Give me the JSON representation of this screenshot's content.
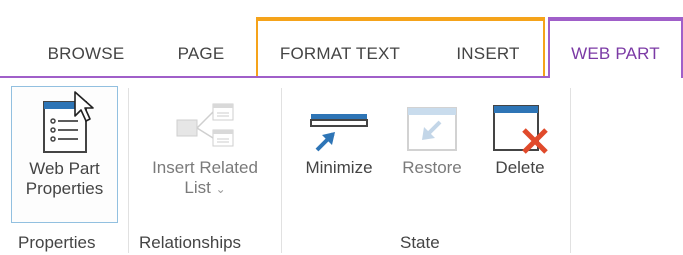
{
  "tabs": [
    {
      "label": "BROWSE"
    },
    {
      "label": "PAGE"
    },
    {
      "label": "FORMAT TEXT"
    },
    {
      "label": "INSERT"
    },
    {
      "label": "WEB PART"
    }
  ],
  "groups": {
    "properties": {
      "label": "Properties",
      "buttons": [
        {
          "label_line1": "Web Part",
          "label_line2": "Properties",
          "icon": "web-part-properties-icon"
        }
      ]
    },
    "relationships": {
      "label": "Relationships",
      "buttons": [
        {
          "label_line1": "Insert Related",
          "label_line2": "List",
          "icon": "insert-related-list-icon",
          "dropdown": "⌄"
        }
      ]
    },
    "state": {
      "label": "State",
      "buttons": [
        {
          "label": "Minimize",
          "icon": "minimize-icon"
        },
        {
          "label": "Restore",
          "icon": "restore-icon"
        },
        {
          "label": "Delete",
          "icon": "delete-icon"
        }
      ]
    }
  },
  "colors": {
    "active_tab": "#7b3aa5",
    "contextual_orange": "#f5a31a",
    "contextual_purple": "#a05fc9",
    "selected_border": "#92c0e0",
    "icon_blue": "#2e75b6",
    "delete_red": "#e04a2b"
  }
}
